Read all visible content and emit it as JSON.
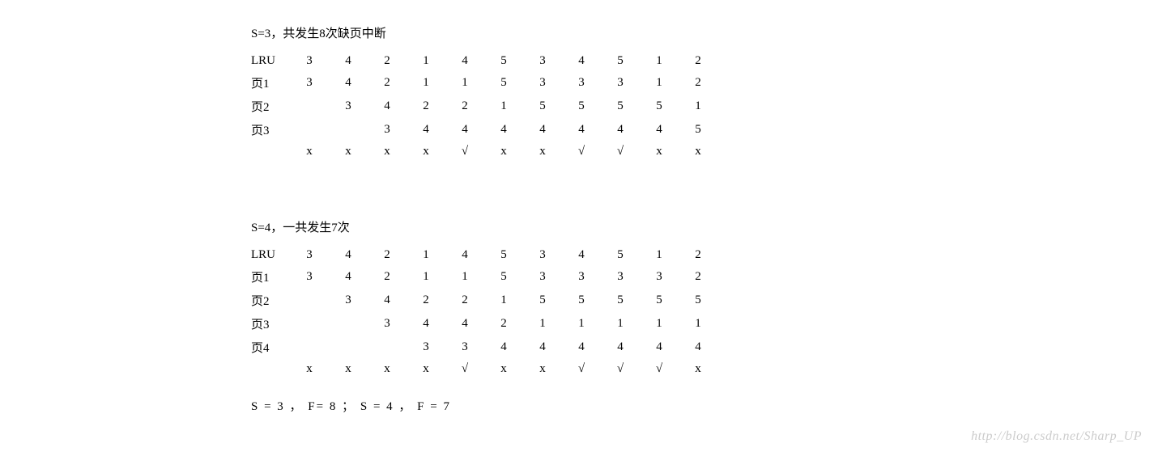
{
  "section1": {
    "title": "S=3，共发生8次缺页中断",
    "rows": [
      {
        "label": "LRU",
        "cells": [
          "3",
          "4",
          "2",
          "1",
          "4",
          "5",
          "3",
          "4",
          "5",
          "1",
          "2"
        ]
      },
      {
        "label": "页1",
        "cells": [
          "3",
          "4",
          "2",
          "1",
          "1",
          "5",
          "3",
          "3",
          "3",
          "1",
          "2"
        ]
      },
      {
        "label": "页2",
        "cells": [
          "",
          "3",
          "4",
          "2",
          "2",
          "1",
          "5",
          "5",
          "5",
          "5",
          "1"
        ]
      },
      {
        "label": "页3",
        "cells": [
          "",
          "",
          "3",
          "4",
          "4",
          "4",
          "4",
          "4",
          "4",
          "4",
          "5"
        ]
      },
      {
        "label": "",
        "cells": [
          "x",
          "x",
          "x",
          "x",
          "√",
          "x",
          "x",
          "√",
          "√",
          "x",
          "x"
        ]
      }
    ]
  },
  "section2": {
    "title": "S=4，一共发生7次",
    "rows": [
      {
        "label": "LRU",
        "cells": [
          "3",
          "4",
          "2",
          "1",
          "4",
          "5",
          "3",
          "4",
          "5",
          "1",
          "2"
        ]
      },
      {
        "label": "页1",
        "cells": [
          "3",
          "4",
          "2",
          "1",
          "1",
          "5",
          "3",
          "3",
          "3",
          "3",
          "2"
        ]
      },
      {
        "label": "页2",
        "cells": [
          "",
          "3",
          "4",
          "2",
          "2",
          "1",
          "5",
          "5",
          "5",
          "5",
          "5"
        ]
      },
      {
        "label": "页3",
        "cells": [
          "",
          "",
          "3",
          "4",
          "4",
          "2",
          "1",
          "1",
          "1",
          "1",
          "1"
        ]
      },
      {
        "label": "页4",
        "cells": [
          "",
          "",
          "",
          "3",
          "3",
          "4",
          "4",
          "4",
          "4",
          "4",
          "4"
        ]
      },
      {
        "label": "",
        "cells": [
          "x",
          "x",
          "x",
          "x",
          "√",
          "x",
          "x",
          "√",
          "√",
          "√",
          "x"
        ]
      }
    ]
  },
  "summary": "S = 3 ， F= 8 ； S = 4 ， F = 7",
  "watermark": "http://blog.csdn.net/Sharp_UP"
}
